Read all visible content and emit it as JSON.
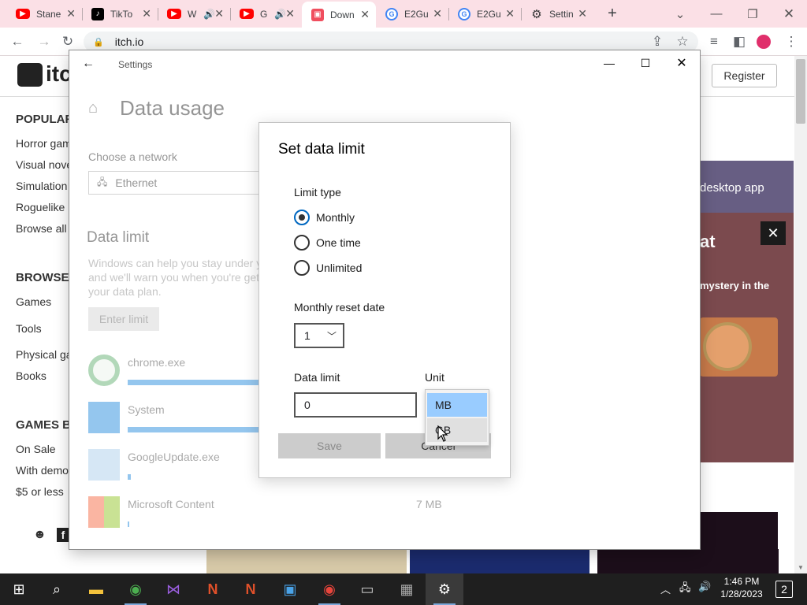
{
  "browser": {
    "tabs": [
      {
        "label": "Stane",
        "icon": "youtube-icon",
        "active": false
      },
      {
        "label": "TikTo",
        "icon": "tiktok-icon",
        "active": false
      },
      {
        "label": "W",
        "icon": "youtube-icon",
        "active": false
      },
      {
        "label": "G",
        "icon": "youtube-icon",
        "active": false
      },
      {
        "label": "Down",
        "icon": "itch-icon",
        "active": true
      },
      {
        "label": "E2Gu",
        "icon": "google-icon",
        "active": false
      },
      {
        "label": "E2Gu",
        "icon": "google-icon",
        "active": false
      },
      {
        "label": "Settin",
        "icon": "gear-icon",
        "active": false
      }
    ],
    "new_tab": "+",
    "url": "itch.io"
  },
  "itch_page": {
    "logo": "itch",
    "register": "Register",
    "sections": [
      {
        "heading": "POPULAR",
        "items": [
          "Horror gam",
          "Visual nove",
          "Simulation",
          "Roguelike",
          "Browse all"
        ]
      },
      {
        "heading": "BROWSE",
        "items": [
          "Games",
          "Tools",
          "Physical ga",
          "Books"
        ]
      },
      {
        "heading": "GAMES BY",
        "items": [
          "On Sale",
          "With demo",
          "$5 or less"
        ]
      }
    ],
    "promo_desktop": "desktop app",
    "promo_at": "at",
    "promo_mystery": "mystery in the",
    "close": "✕"
  },
  "settings": {
    "title": "Settings",
    "page_title": "Data usage",
    "choose_network": "Choose a network",
    "network_value": "Ethernet",
    "data_limit_heading": "Data limit",
    "data_limit_desc": [
      "Windows can help you stay under y",
      "and we'll warn you when you're get",
      "your data plan."
    ],
    "enter_limit": "Enter limit",
    "apps": [
      {
        "name": "chrome.exe",
        "bar": 0.85
      },
      {
        "name": "System",
        "bar": 0.85
      },
      {
        "name": "GoogleUpdate.exe",
        "bar": 0.02
      },
      {
        "name": "Microsoft Content",
        "bar": 0.004,
        "usage": "7 MB"
      }
    ]
  },
  "dialog": {
    "title": "Set data limit",
    "limit_type_label": "Limit type",
    "options": [
      "Monthly",
      "One time",
      "Unlimited"
    ],
    "selected": "Monthly",
    "reset_label": "Monthly reset date",
    "reset_value": "1",
    "data_limit_label": "Data limit",
    "data_limit_value": "0",
    "unit_label": "Unit",
    "unit_options": [
      "MB",
      "GB"
    ],
    "unit_selected": "MB",
    "save": "Save",
    "cancel": "Cancel"
  },
  "taskbar": {
    "time": "1:46 PM",
    "date": "1/28/2023",
    "notifications": "2"
  },
  "colors": {
    "tabstrip": "#fbe0e6",
    "accent": "#0067c0",
    "selection": "#99ccff",
    "taskbar": "#1f1f1f"
  }
}
